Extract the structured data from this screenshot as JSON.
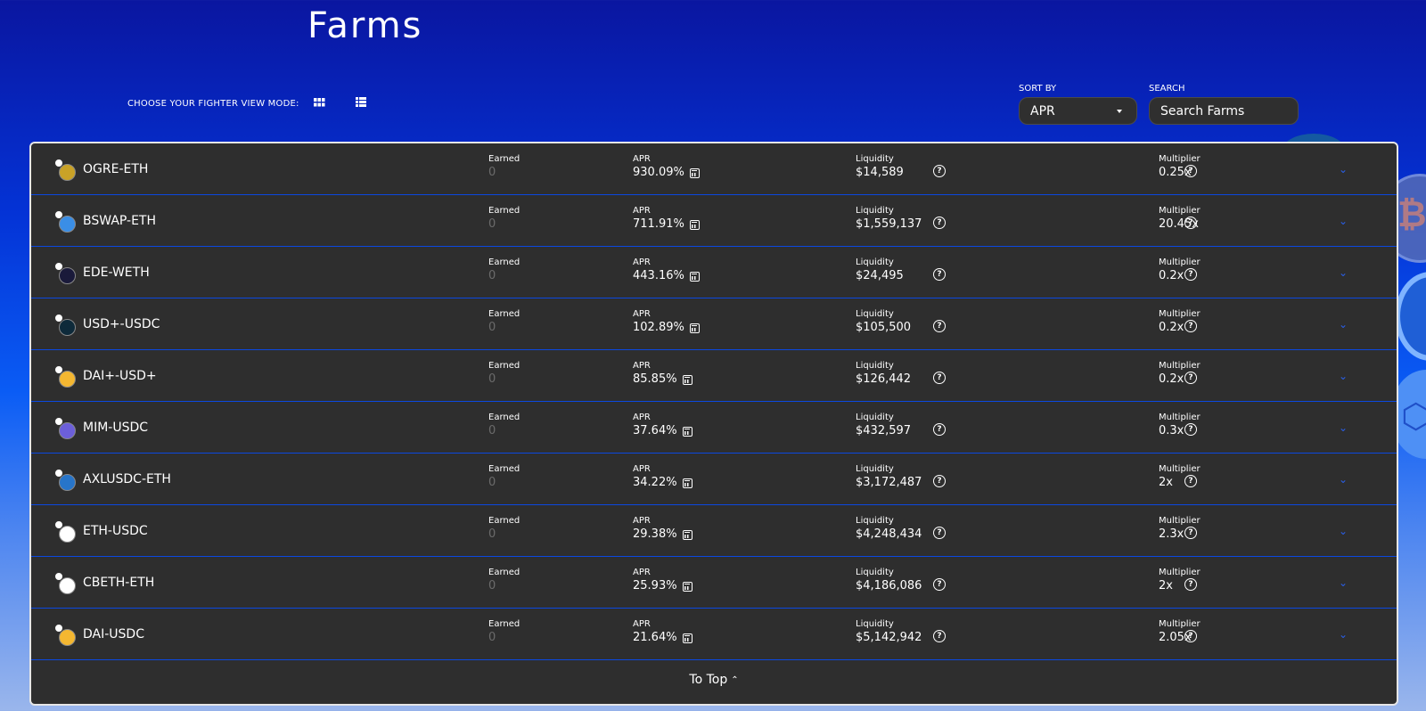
{
  "page_title": "Farms",
  "view_mode": {
    "label": "CHOOSE YOUR FIGHTER VIEW MODE:"
  },
  "sort": {
    "label": "SORT BY",
    "value": "APR"
  },
  "search": {
    "label": "SEARCH",
    "placeholder": "Search Farms"
  },
  "columns": {
    "earned": "Earned",
    "apr": "APR",
    "liquidity": "Liquidity",
    "multiplier": "Multiplier"
  },
  "farms": [
    {
      "pair": "OGRE-ETH",
      "earned": "0",
      "apr": "930.09%",
      "liquidity": "$14,589",
      "multiplier": "0.25x",
      "icon": "ogre-token-icon",
      "color": "#c9a227"
    },
    {
      "pair": "BSWAP-ETH",
      "earned": "0",
      "apr": "711.91%",
      "liquidity": "$1,559,137",
      "multiplier": "20.45x",
      "icon": "bswap-token-icon",
      "color": "#3a8ee6"
    },
    {
      "pair": "EDE-WETH",
      "earned": "0",
      "apr": "443.16%",
      "liquidity": "$24,495",
      "multiplier": "0.2x",
      "icon": "ede-token-icon",
      "color": "#1a1a3a"
    },
    {
      "pair": "USD+-USDC",
      "earned": "0",
      "apr": "102.89%",
      "liquidity": "$105,500",
      "multiplier": "0.2x",
      "icon": "usdplus-token-icon",
      "color": "#0e2a3a"
    },
    {
      "pair": "DAI+-USD+",
      "earned": "0",
      "apr": "85.85%",
      "liquidity": "$126,442",
      "multiplier": "0.2x",
      "icon": "daiplus-token-icon",
      "color": "#f4b731"
    },
    {
      "pair": "MIM-USDC",
      "earned": "0",
      "apr": "37.64%",
      "liquidity": "$432,597",
      "multiplier": "0.3x",
      "icon": "mim-token-icon",
      "color": "#6c5fd9"
    },
    {
      "pair": "AXLUSDC-ETH",
      "earned": "0",
      "apr": "34.22%",
      "liquidity": "$3,172,487",
      "multiplier": "2x",
      "icon": "axlusdc-token-icon",
      "color": "#2775ca"
    },
    {
      "pair": "ETH-USDC",
      "earned": "0",
      "apr": "29.38%",
      "liquidity": "$4,248,434",
      "multiplier": "2.3x",
      "icon": "eth-token-icon",
      "color": "#ffffff"
    },
    {
      "pair": "CBETH-ETH",
      "earned": "0",
      "apr": "25.93%",
      "liquidity": "$4,186,086",
      "multiplier": "2x",
      "icon": "cbeth-token-icon",
      "color": "#ffffff"
    },
    {
      "pair": "DAI-USDC",
      "earned": "0",
      "apr": "21.64%",
      "liquidity": "$5,142,942",
      "multiplier": "2.05x",
      "icon": "dai-token-icon",
      "color": "#f4b731"
    }
  ],
  "to_top": "To Top",
  "colors": {
    "row_bg": "#2e2e2e",
    "row_divider": "#0b48e0",
    "chevron": "#2a5fe8"
  }
}
